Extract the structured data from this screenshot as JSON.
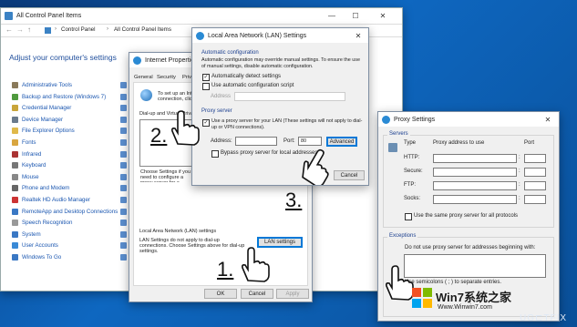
{
  "control_panel": {
    "title": "All Control Panel Items",
    "breadcrumb": [
      "Control Panel",
      "All Control Panel Items"
    ],
    "heading": "Adjust your computer's settings",
    "items": [
      {
        "label": "Administrative Tools",
        "color": "#8a7a5a"
      },
      {
        "label": "Backup and Restore (Windows 7)",
        "color": "#4f9a3e"
      },
      {
        "label": "Credential Manager",
        "color": "#c9a53a"
      },
      {
        "label": "Device Manager",
        "color": "#6a7a8c"
      },
      {
        "label": "File Explorer Options",
        "color": "#e0b94a"
      },
      {
        "label": "Fonts",
        "color": "#d9a640"
      },
      {
        "label": "Infrared",
        "color": "#a33"
      },
      {
        "label": "Keyboard",
        "color": "#777"
      },
      {
        "label": "Mouse",
        "color": "#888"
      },
      {
        "label": "Phone and Modem",
        "color": "#666"
      },
      {
        "label": "Realtek HD Audio Manager",
        "color": "#c33"
      },
      {
        "label": "RemoteApp and Desktop Connections",
        "color": "#3a78c4"
      },
      {
        "label": "Speech Recognition",
        "color": "#999"
      },
      {
        "label": "System",
        "color": "#3a78c4"
      },
      {
        "label": "User Accounts",
        "color": "#3a8ad6"
      },
      {
        "label": "Windows To Go",
        "color": "#3a78c4"
      }
    ]
  },
  "internet_properties": {
    "title": "Internet Properties",
    "tabs": [
      "General",
      "Security",
      "Privacy"
    ],
    "setup_text": "To set up an Internet connection, click Setup.",
    "dialup_label": "Dial-up and Virtual Private Network settings",
    "choose_text": "Choose Settings if you need to configure a proxy server for a connection.",
    "lan_group": "Local Area Network (LAN) settings",
    "lan_text": "LAN Settings do not apply to dial-up connections. Choose Settings above for dial-up settings.",
    "lan_button": "LAN settings",
    "ok": "OK",
    "cancel": "Cancel",
    "apply": "Apply"
  },
  "lan_dialog": {
    "title": "Local Area Network (LAN) Settings",
    "auto_config_group": "Automatic configuration",
    "auto_config_text": "Automatic configuration may override manual settings. To ensure the use of manual settings, disable automatic configuration.",
    "auto_detect": "Automatically detect settings",
    "use_script": "Use automatic configuration script",
    "address_label": "Address",
    "proxy_group": "Proxy server",
    "use_proxy": "Use a proxy server for your LAN (These settings will not apply to dial-up or VPN connections).",
    "proxy_address_label": "Address:",
    "port_label": "Port:",
    "port_value": "80",
    "advanced": "Advanced",
    "bypass": "Bypass proxy server for local addresses",
    "cancel": "Cancel"
  },
  "proxy_settings": {
    "title": "Proxy Settings",
    "servers_group": "Servers",
    "col_type": "Type",
    "col_addr": "Proxy address to use",
    "col_port": "Port",
    "rows": [
      "HTTP:",
      "Secure:",
      "FTP:",
      "Socks:"
    ],
    "same_proxy": "Use the same proxy server for all protocols",
    "exceptions_group": "Exceptions",
    "exceptions_text": "Do not use proxy server for addresses beginning with:",
    "sep_text": "Use semicolons ( ; ) to separate entries."
  },
  "steps": [
    "1.",
    "2.",
    "3."
  ],
  "watermark": {
    "brand": "Win7系统之家",
    "url": "Www.Winwin7.com",
    "ugetfix": "UG⊏TFIX"
  }
}
